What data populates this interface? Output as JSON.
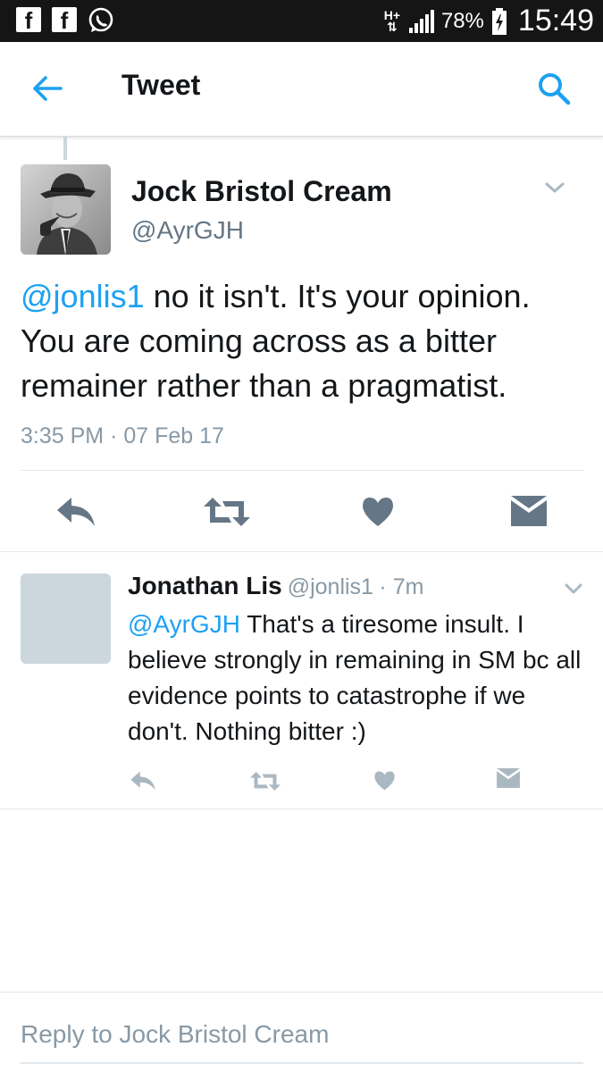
{
  "status_bar": {
    "fb_icon_letter": "f",
    "network_top": "H+",
    "network_bottom": "⇅",
    "battery_percent": "78%",
    "time": "15:49"
  },
  "app_bar": {
    "title": "Tweet"
  },
  "main_tweet": {
    "author_name": "Jock Bristol Cream",
    "author_handle": "@AyrGJH",
    "mention": "@jonlis1",
    "text": " no it isn't. It's your opinion. You are coming across as a bitter remainer rather than a pragmatist.",
    "timestamp": "3:35 PM · 07 Feb 17"
  },
  "reply_tweet": {
    "author_name": "Jonathan Lis",
    "author_handle": "@jonlis1",
    "age": "· 7m",
    "mention": "@AyrGJH",
    "text": " That's a tiresome insult. I believe strongly in remaining in SM bc all evidence points to catastrophe if we don't. Nothing bitter :)"
  },
  "composer": {
    "placeholder": "Reply to Jock Bristol Cream"
  },
  "colors": {
    "accent": "#1da1f2",
    "icon_gray": "#657786",
    "icon_light": "#aab8c2"
  },
  "icons": [
    "facebook-icon",
    "whatsapp-icon",
    "signal-icon",
    "battery-icon",
    "back-arrow-icon",
    "search-icon",
    "chevron-down-icon",
    "reply-icon",
    "retweet-icon",
    "like-icon",
    "direct-message-icon"
  ]
}
